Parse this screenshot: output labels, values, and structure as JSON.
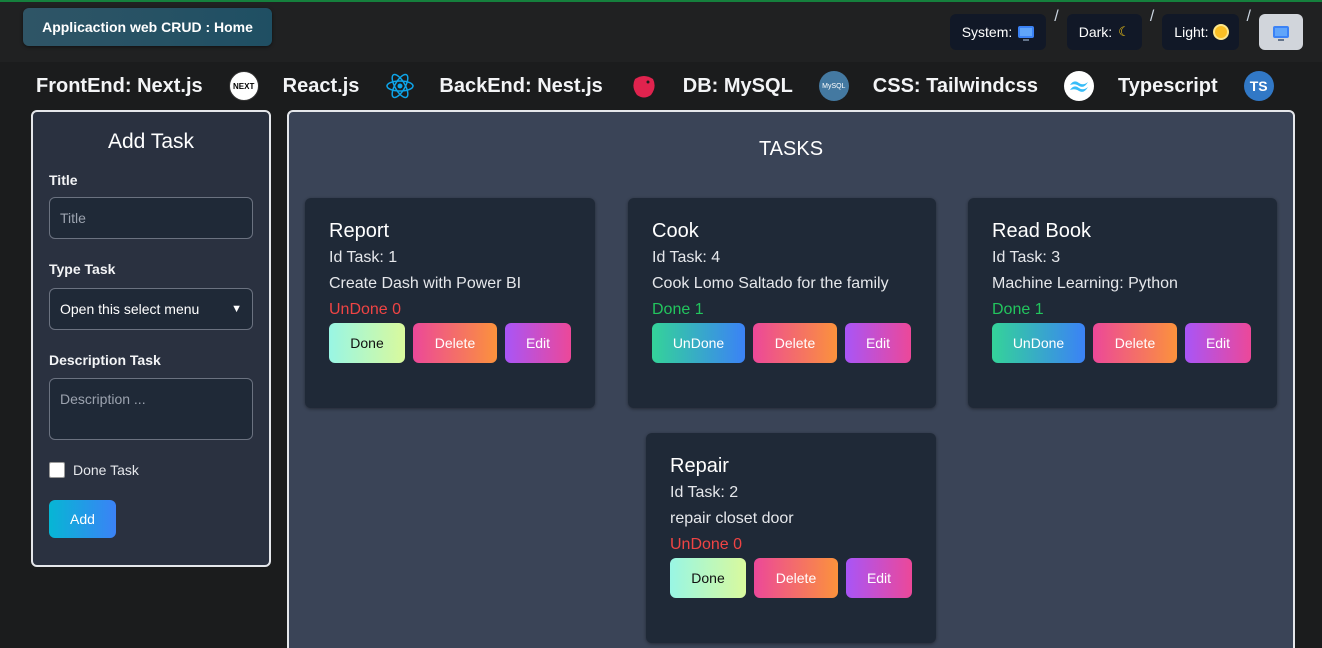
{
  "header": {
    "home_label": "Applicaction web CRUD : Home",
    "theme": {
      "system_label": "System:",
      "dark_label": "Dark:",
      "light_label": "Light:",
      "separator": "/"
    }
  },
  "tech": [
    {
      "label": "FrontEnd: Next.js",
      "logo": "NEXT"
    },
    {
      "label": "React.js",
      "logo": ""
    },
    {
      "label": "BackEnd: Nest.js",
      "logo": ""
    },
    {
      "label": "DB: MySQL",
      "logo": "MySQL"
    },
    {
      "label": "CSS: Tailwindcss",
      "logo": ""
    },
    {
      "label": "Typescript",
      "logo": "TS"
    }
  ],
  "form": {
    "title": "Add Task",
    "title_label": "Title",
    "title_placeholder": "Title",
    "type_label": "Type Task",
    "type_selected": "Open this select menu",
    "description_label": "Description Task",
    "description_placeholder": "Description ...",
    "done_label": "Done Task",
    "add_label": "Add"
  },
  "tasks_panel": {
    "title": "TASKS",
    "buttons": {
      "done": "Done",
      "undone": "UnDone",
      "delete": "Delete",
      "edit": "Edit"
    },
    "tasks": [
      {
        "title": "Report",
        "id_text": "Id Task: 1",
        "description": "Create Dash with Power BI",
        "status": "UnDone 0"
      },
      {
        "title": "Cook",
        "id_text": "Id Task: 4",
        "description": "Cook Lomo Saltado for the family",
        "status": "Done 1"
      },
      {
        "title": "Read Book",
        "id_text": "Id Task: 3",
        "description": "Machine Learning: Python",
        "status": "Done 1"
      },
      {
        "title": "Repair",
        "id_text": "Id Task: 2",
        "description": "repair closet door",
        "status": "UnDone 0"
      }
    ]
  }
}
